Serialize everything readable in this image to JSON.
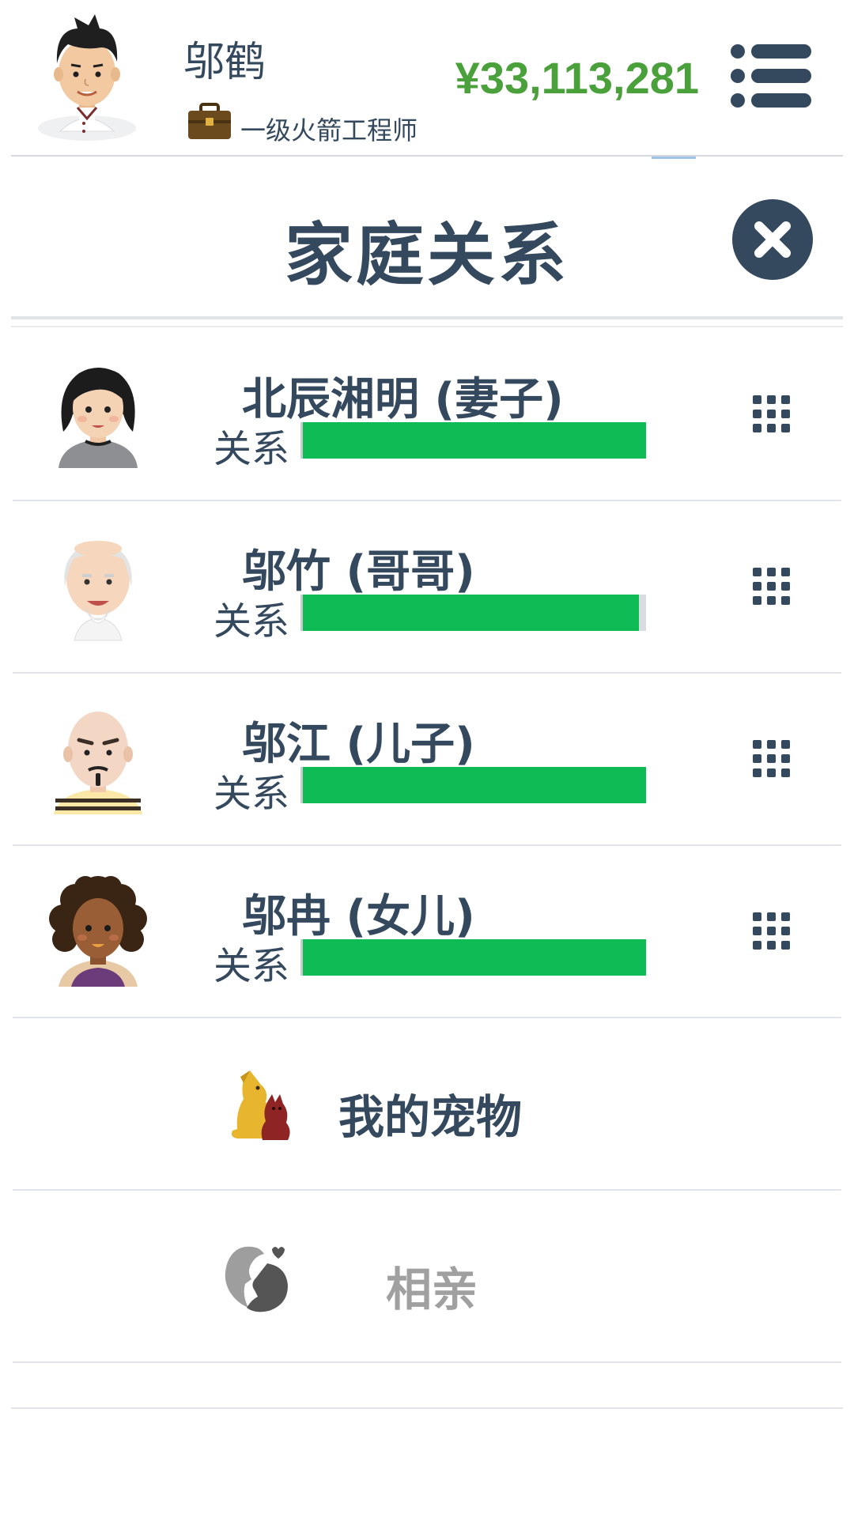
{
  "header": {
    "player_name": "邬鹤",
    "job_title": "一级火箭工程师",
    "money": "¥33,113,281"
  },
  "modal": {
    "title": "家庭关系"
  },
  "relation_label": "关系",
  "family": [
    {
      "name": "北辰湘明 (妻子)",
      "relationship": 1.0,
      "avatar": "woman-short-black-hair"
    },
    {
      "name": "邬竹 (哥哥)",
      "relationship": 0.98,
      "avatar": "old-man-white-beard"
    },
    {
      "name": "邬江 (儿子)",
      "relationship": 1.0,
      "avatar": "bald-man-goatee"
    },
    {
      "name": "邬冉 (女儿)",
      "relationship": 1.0,
      "avatar": "woman-curly-hair"
    }
  ],
  "entries": {
    "pets": {
      "label": "我的宠物",
      "icon": "pet-dog-cat-icon",
      "color": "#34495e"
    },
    "blind_date": {
      "label": "相亲",
      "icon": "couple-heart-icon",
      "color": "#a0a0a0"
    }
  },
  "colors": {
    "money": "#4aa03a",
    "bar_fill": "#0fbb54",
    "text": "#34495e"
  }
}
